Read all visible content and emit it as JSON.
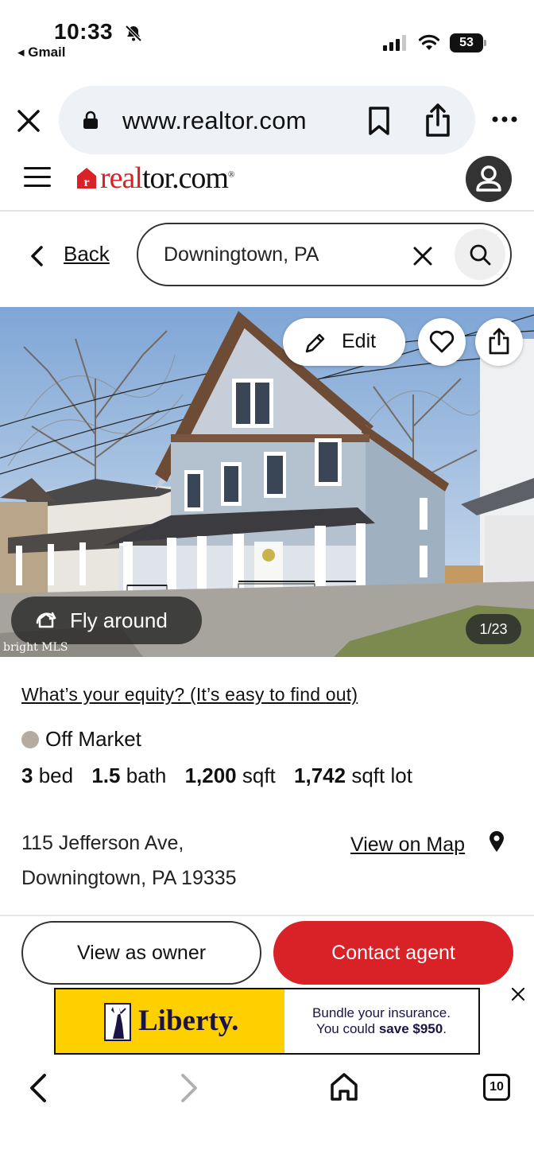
{
  "status_bar": {
    "time": "10:33",
    "back_app": "◂ Gmail",
    "battery": "53"
  },
  "browser": {
    "url": "www.realtor.com"
  },
  "site": {
    "logo_red": "real",
    "logo_dark": "tor.com",
    "logo_reg": "®"
  },
  "search": {
    "back_label": "Back",
    "query": "Downingtown, PA"
  },
  "photo": {
    "edit_label": "Edit",
    "fly_around_label": "Fly around",
    "counter": "1/23",
    "watermark": "bright MLS"
  },
  "listing": {
    "equity_link": "What’s your equity? (It’s easy to find out)",
    "status": "Off Market",
    "status_color": "#b5ab9e",
    "beds_value": "3",
    "beds_unit": "bed",
    "baths_value": "1.5",
    "baths_unit": "bath",
    "sqft_value": "1,200",
    "sqft_unit": "sqft",
    "lot_value": "1,742",
    "lot_unit": "sqft lot",
    "address_line1": "115 Jefferson Ave,",
    "address_line2": "Downingtown, PA 19335",
    "map_link": "View on Map"
  },
  "actions": {
    "owner_label": "View as owner",
    "contact_label": "Contact agent",
    "accent_color": "#d92228"
  },
  "ad": {
    "brand": "Liberty.",
    "line1": "Bundle your insurance.",
    "line2_prefix": "You could ",
    "line2_bold": "save $950",
    "line2_suffix": "."
  },
  "bottom_nav": {
    "tab_count": "10"
  }
}
